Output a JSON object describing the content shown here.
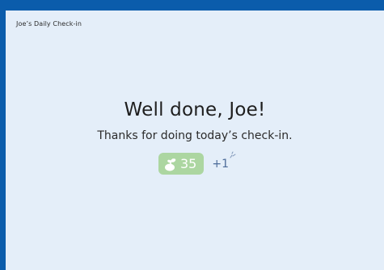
{
  "app": {
    "title": "Joe’s Daily Check-in"
  },
  "main": {
    "headline": "Well done, Joe!",
    "subtext": "Thanks for doing today’s check-in."
  },
  "score": {
    "value": "35",
    "increment": "+1",
    "icon": "seed-icon",
    "sparkle_icon": "sparkle-icon",
    "badge_color": "#acd6a1"
  },
  "colors": {
    "frame": "#0b5cab",
    "background": "#e4eef9",
    "increment_text": "#4d6c9a"
  }
}
